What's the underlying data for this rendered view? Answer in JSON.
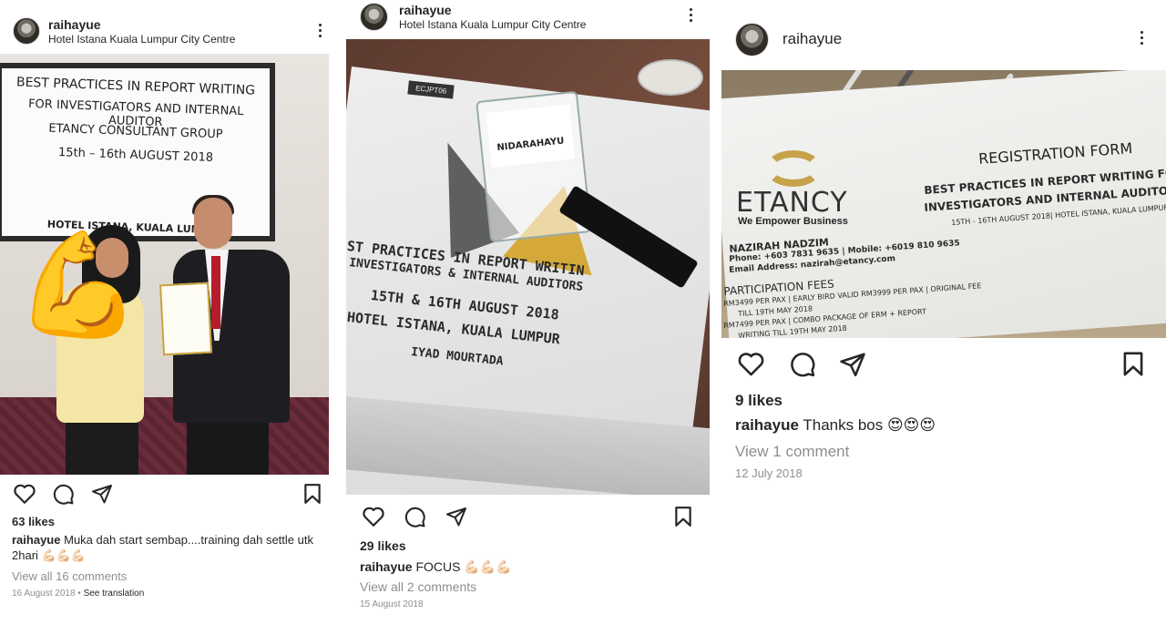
{
  "posts": [
    {
      "username": "raihayue",
      "location": "Hotel Istana Kuala Lumpur City Centre",
      "photo": {
        "banner_lines": [
          "BEST PRACTICES IN REPORT WRITING",
          "FOR INVESTIGATORS AND INTERNAL AUDITOR",
          "ETANCY CONSULTANT GROUP",
          "15th – 16th AUGUST 2018"
        ],
        "banner_bottom": "HOTEL ISTANA, KUALA LUMPUR",
        "overlay_emoji": "💪"
      },
      "likes": "63 likes",
      "caption_user": "raihayue",
      "caption_text": "Muka dah start sembap....training dah settle utk 2hari 💪🏻💪🏻💪🏻",
      "view_comments": "View all 16 comments",
      "date": "16 August 2018",
      "see_translation": "See translation"
    },
    {
      "username": "raihayue",
      "location": "Hotel Istana Kuala Lumpur City Centre",
      "photo": {
        "code": "ECJPT06",
        "tag_name": "NIDARAHAYU",
        "lines": [
          "ST PRACTICES IN REPORT WRITIN",
          "INVESTIGATORS &  INTERNAL AUDITORS",
          "15TH & 16TH AUGUST 2018",
          "HOTEL ISTANA, KUALA LUMPUR",
          "IYAD MOURTADA"
        ]
      },
      "likes": "29 likes",
      "caption_user": "raihayue",
      "caption_text": "FOCUS 💪🏻💪🏻💪🏻",
      "view_comments": "View all 2 comments",
      "date": "15 August 2018"
    },
    {
      "username": "raihayue",
      "photo": {
        "brand": "ETANCY",
        "tagline": "We Empower Business",
        "form_title": "REGISTRATION FORM",
        "heading_lines": [
          "BEST PRACTICES IN REPORT WRITING FOR",
          "INVESTIGATORS AND INTERNAL AUDITORS",
          "15TH - 16TH AUGUST 2018| HOTEL ISTANA, KUALA LUMPUR"
        ],
        "details": [
          "NAZIRAH NADZIM",
          "Phone: +603 7831 9635 | Mobile: +6019 810 9635",
          "Email Address: nazirah@etancy.com",
          "PARTICIPATION FEES",
          "RM3499 PER PAX | EARLY BIRD VALID   RM3999 PER PAX | ORIGINAL FEE",
          "TILL 19TH MAY 2018",
          "RM7499 PER PAX | COMBO PACKAGE OF ERM + REPORT",
          "WRITING TILL 19TH MAY 2018"
        ]
      },
      "likes": "9 likes",
      "caption_user": "raihayue",
      "caption_text": "Thanks bos 😍😍😍",
      "view_comments": "View 1 comment",
      "date": "12 July 2018"
    }
  ],
  "icons": [
    "like-heart-icon",
    "comment-icon",
    "share-icon",
    "bookmark-icon",
    "more-options-icon"
  ]
}
